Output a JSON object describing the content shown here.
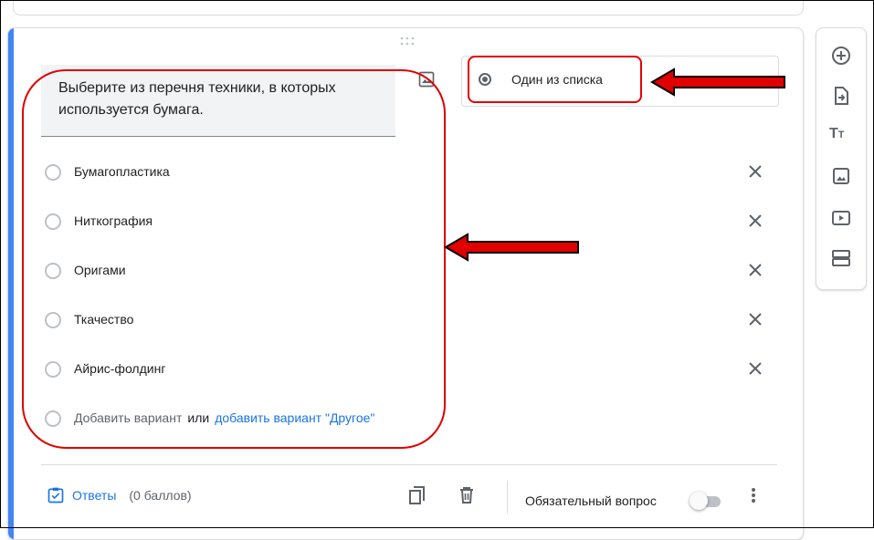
{
  "question": {
    "title": "Выберите из перечня техники, в которых используется бумага.",
    "type_label": "Один из списка"
  },
  "options": [
    {
      "label": "Бумагопластика"
    },
    {
      "label": "Ниткография"
    },
    {
      "label": "Оригами"
    },
    {
      "label": "Ткачество"
    },
    {
      "label": "Айрис-фолдинг"
    }
  ],
  "add_option": {
    "label": "Добавить вариант",
    "or": "или",
    "other_link": "добавить вариант \"Другое\""
  },
  "footer": {
    "answers_link": "Ответы",
    "points": "(0 баллов)",
    "required_label": "Обязательный вопрос",
    "required_on": false
  },
  "icons": {
    "drag": "drag-handle-icon",
    "image": "image-icon",
    "remove": "close-icon",
    "copy": "copy-icon",
    "delete": "trash-icon",
    "more": "more-vert-icon",
    "answers": "checkbox-checked-icon",
    "toolbar": [
      "add-circle-icon",
      "import-icon",
      "title-icon",
      "image-icon",
      "video-icon",
      "section-icon"
    ]
  },
  "colors": {
    "accent": "#4285f4",
    "link": "#1a73e8",
    "annotation": "#e00000"
  }
}
